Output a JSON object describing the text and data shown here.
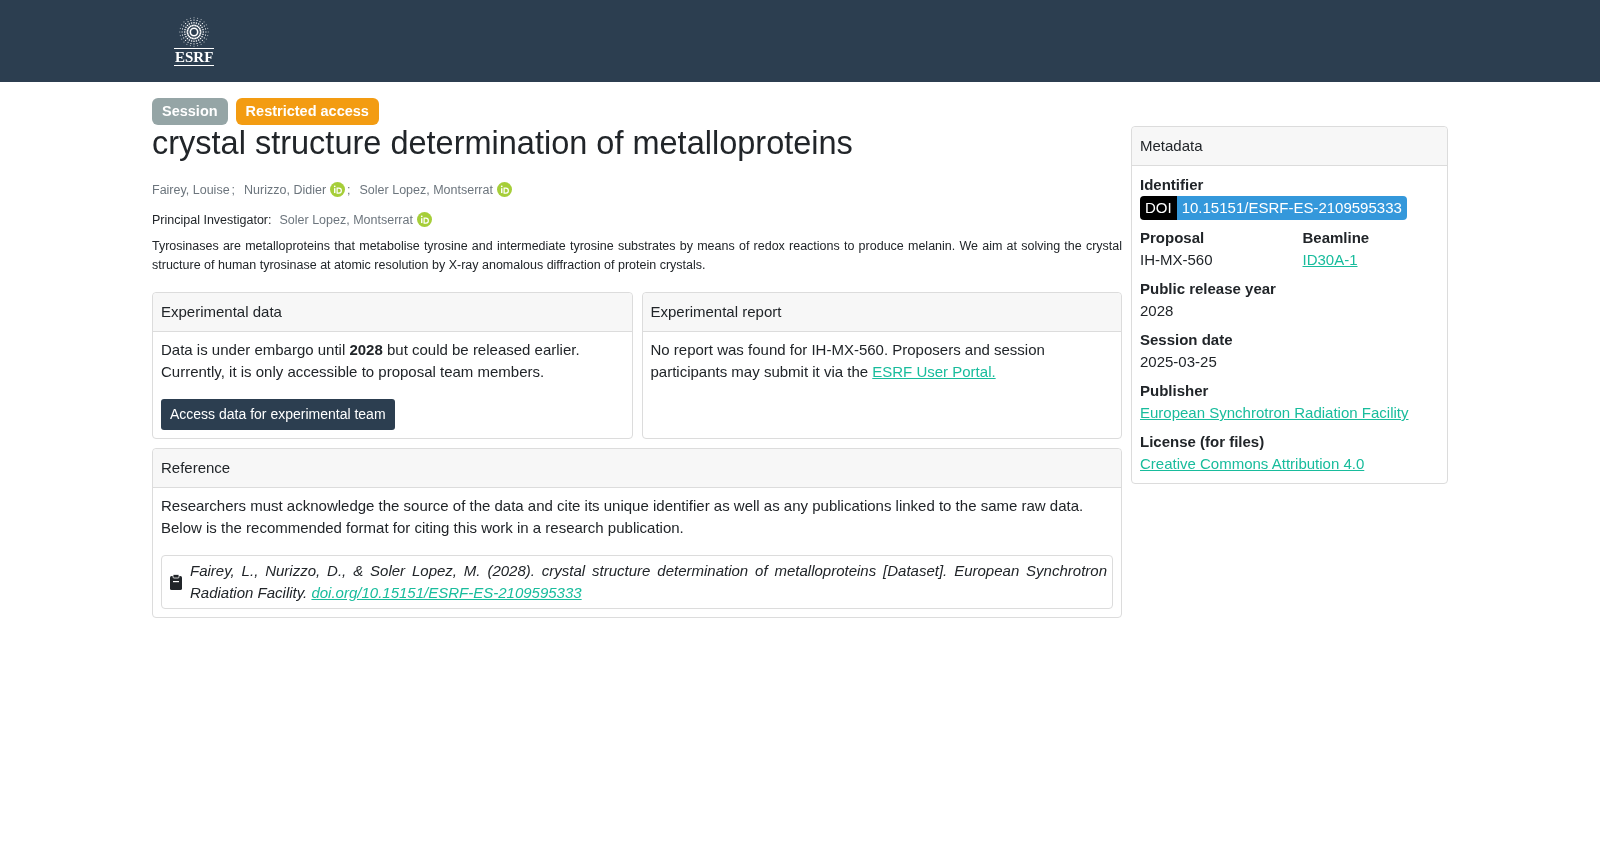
{
  "header": {
    "logo_text": "ESRF"
  },
  "badges": [
    {
      "label": "Session",
      "color": "#95a5a6"
    },
    {
      "label": "Restricted access",
      "color": "#f39c12"
    }
  ],
  "title": "crystal structure determination of metalloproteins",
  "authors": [
    {
      "name": "Fairey, Louise",
      "orcid": false,
      "separator": ";"
    },
    {
      "name": "Nurizzo, Didier",
      "orcid": true,
      "separator": ";"
    },
    {
      "name": "Soler Lopez, Montserrat",
      "orcid": true
    }
  ],
  "principal_investigator": {
    "label": "Principal Investigator:",
    "name": "Soler Lopez, Montserrat",
    "orcid": true
  },
  "description": "Tyrosinases are metalloproteins that metabolise tyrosine and intermediate tyrosine substrates by means of redox reactions to produce melanin. We aim at solving the crystal structure of human tyrosinase at atomic resolution by X-ray anomalous diffraction of protein crystals.",
  "experimental_data": {
    "title": "Experimental data",
    "text": "Data is under embargo until **2028** but could be released earlier. Currently, it is only accessible to proposal team members.",
    "button": "Access data for experimental team"
  },
  "experimental_report": {
    "title": "Experimental report",
    "text": "No report was found for IH-MX-560. Proposers and session participants may submit it via the",
    "link": "ESRF User Portal."
  },
  "reference": {
    "title": "Reference",
    "paragraphs": [
      "Researchers must acknowledge the source of the data and cite its unique identifier as well as any publications linked to the same raw data.",
      "Below is the recommended format for citing this work in a research publication."
    ],
    "citation": {
      "text": "Fairey, L., Nurizzo, D., & Soler Lopez, M. (2028). crystal structure determination of metalloproteins [Dataset]. European Synchrotron Radiation Facility.",
      "link": "doi.org/10.15151/ESRF-ES-2109595333"
    }
  },
  "metadata": {
    "title": "Metadata",
    "identifier": {
      "label": "Identifier",
      "scheme": "DOI",
      "value": "10.15151/ESRF-ES-2109595333"
    },
    "rows": [
      [
        {
          "label": "Proposal",
          "value": "IH-MX-560",
          "kind": "text"
        },
        {
          "label": "Beamline",
          "value": "ID30A-1",
          "kind": "link"
        }
      ],
      [
        {
          "label": "Public release year",
          "value": "2028",
          "kind": "text"
        }
      ],
      [
        {
          "label": "Session date",
          "value": "2025-03-25",
          "kind": "text"
        }
      ],
      [
        {
          "label": "Publisher",
          "value": "European Synchrotron Radiation Facility",
          "kind": "link"
        }
      ],
      [
        {
          "label": "License (for files)",
          "value": "Creative Commons Attribution 4.0",
          "kind": "link"
        }
      ]
    ]
  }
}
